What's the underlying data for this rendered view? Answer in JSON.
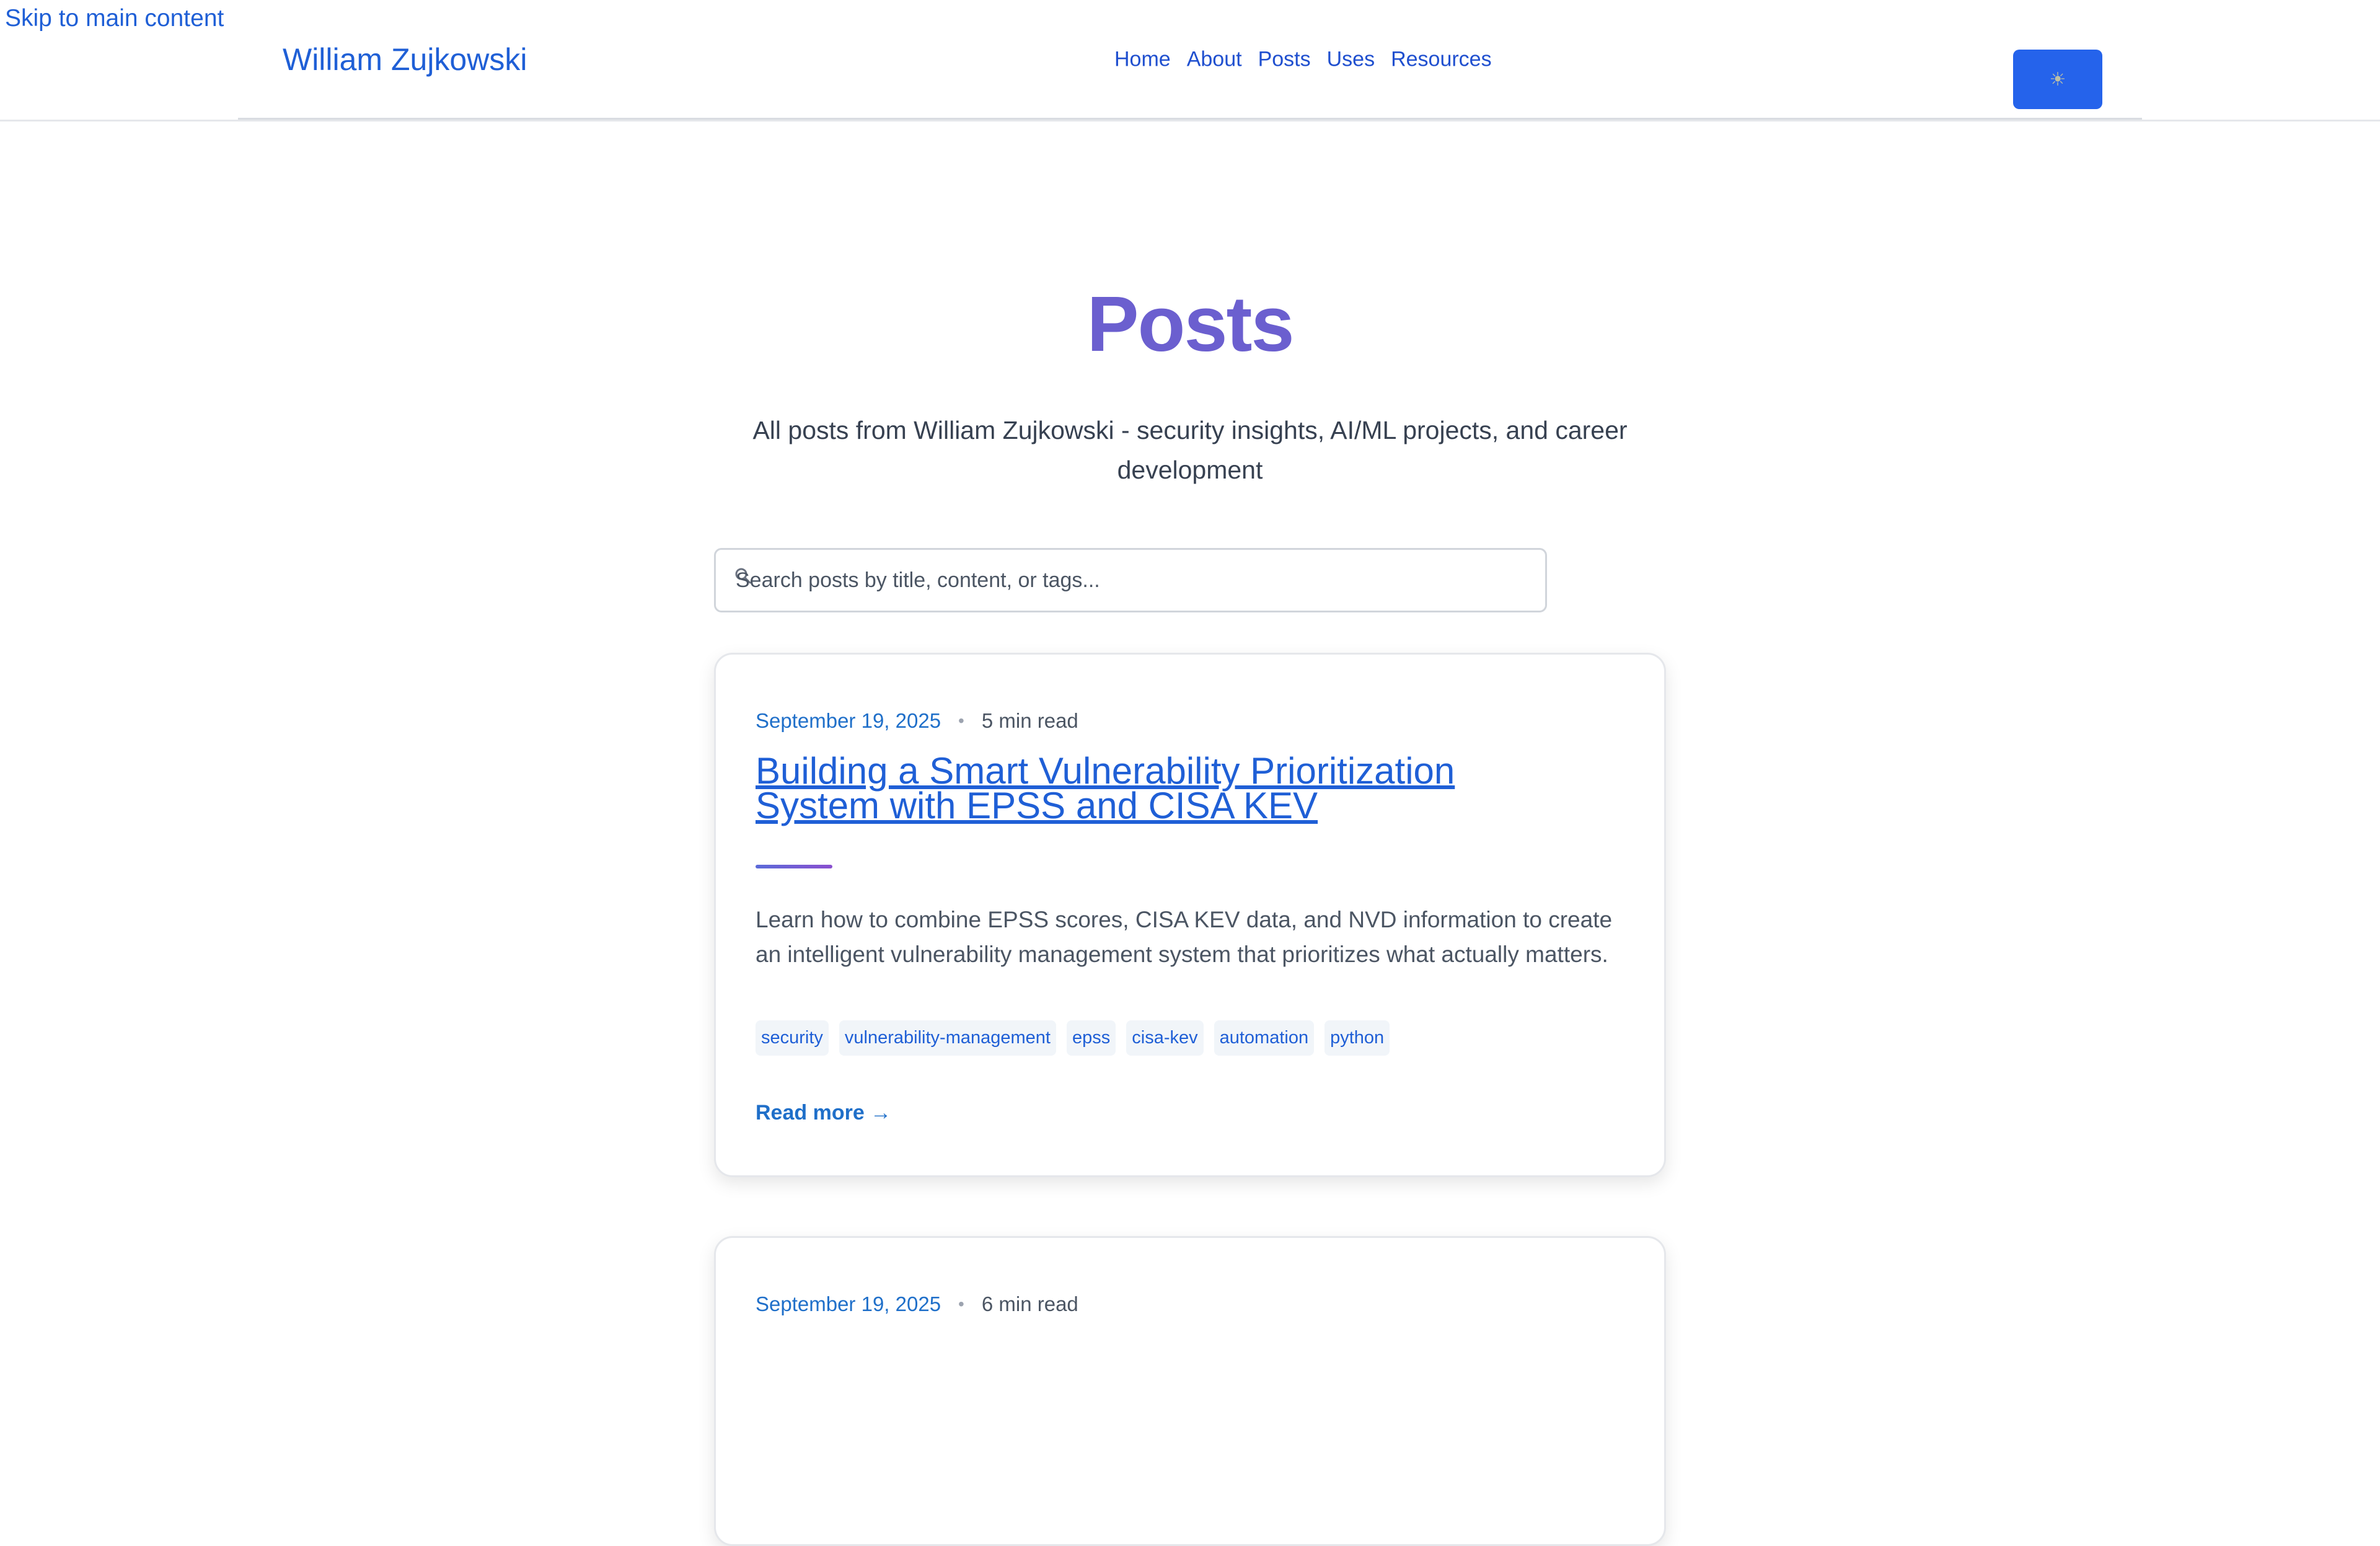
{
  "skip_link": "Skip to main content",
  "header": {
    "brand": "William Zujkowski",
    "nav": [
      "Home",
      "About",
      "Posts",
      "Uses",
      "Resources"
    ],
    "theme_toggle_icon": "sun-icon"
  },
  "main": {
    "title": "Posts",
    "subtitle": "All posts from William Zujkowski - security insights, AI/ML projects, and career development",
    "search": {
      "placeholder": "Search posts by title, content, or tags..."
    },
    "posts": [
      {
        "date": "September 19, 2025",
        "read_time": "5 min read",
        "title": "Building a Smart Vulnerability Prioritization System with EPSS and CISA KEV",
        "excerpt": "Learn how to combine EPSS scores, CISA KEV data, and NVD information to create an intelligent vulnerability management system that prioritizes what actually matters.",
        "tags": [
          "security",
          "vulnerability-management",
          "epss",
          "cisa-kev",
          "automation",
          "python"
        ],
        "read_more": "Read more →"
      },
      {
        "date": "September 19, 2025",
        "read_time": "6 min read"
      }
    ]
  },
  "colors": {
    "link": "#1f5fd6",
    "title_purple": "#6b5fcf",
    "button": "#2563eb"
  }
}
